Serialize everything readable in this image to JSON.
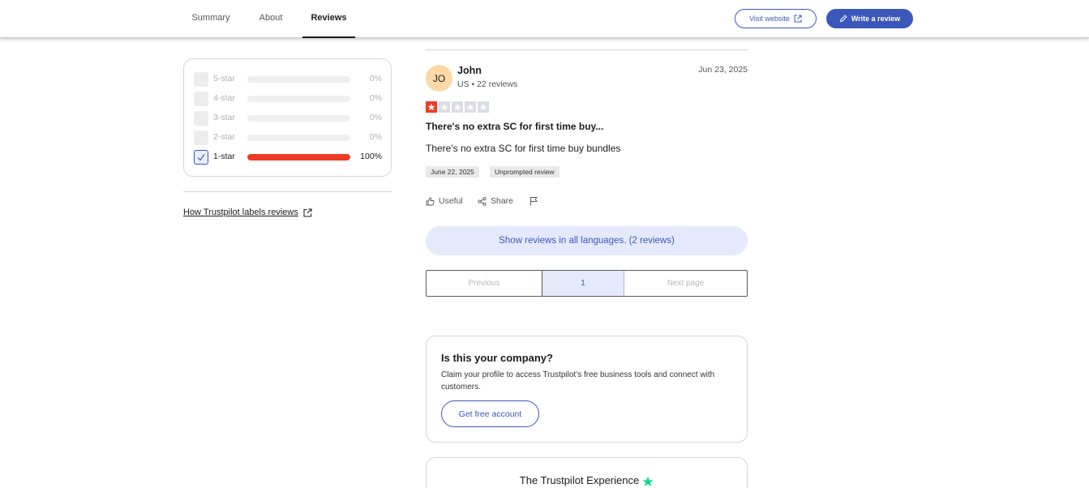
{
  "nav": {
    "tabs": [
      {
        "label": "Summary",
        "active": false
      },
      {
        "label": "About",
        "active": false
      },
      {
        "label": "Reviews",
        "active": true
      }
    ],
    "visit_website": "Visit website",
    "write_review": "Write a review"
  },
  "filters": {
    "rows": [
      {
        "label": "5-star",
        "percent_text": "0%",
        "fraction": 0,
        "checked": false
      },
      {
        "label": "4-star",
        "percent_text": "0%",
        "fraction": 0,
        "checked": false
      },
      {
        "label": "3-star",
        "percent_text": "0%",
        "fraction": 0,
        "checked": false
      },
      {
        "label": "2-star",
        "percent_text": "0%",
        "fraction": 0,
        "checked": false
      },
      {
        "label": "1-star",
        "percent_text": "100%",
        "fraction": 1,
        "checked": true
      }
    ],
    "how_link": "How Trustpilot labels reviews"
  },
  "review": {
    "avatar_initials": "JO",
    "name": "John",
    "meta": "US • 22 reviews",
    "date": "Jun 23, 2025",
    "rating": 1,
    "rating_max": 5,
    "title": "There's no extra SC for first time buy...",
    "body": "There's no extra SC for first time buy bundles",
    "chips": [
      "June 22, 2025",
      "Unprompted review"
    ],
    "actions": {
      "useful": "Useful",
      "share": "Share"
    }
  },
  "show_all_languages": "Show reviews in all languages. (2 reviews)",
  "pagination": {
    "previous": "Previous",
    "current": "1",
    "next": "Next page"
  },
  "company_card": {
    "title": "Is this your company?",
    "text": "Claim your profile to access Trustpilot’s free business tools and connect with customers.",
    "button": "Get free account"
  },
  "experience_card": {
    "title": "The Trustpilot Experience"
  },
  "colors": {
    "accent": "#3c57bc",
    "star_red": "#ef3a25",
    "trustpilot_green": "#04da8d",
    "avatar_bg": "#fcd9a7",
    "highlight_bg": "#e4eafc"
  }
}
